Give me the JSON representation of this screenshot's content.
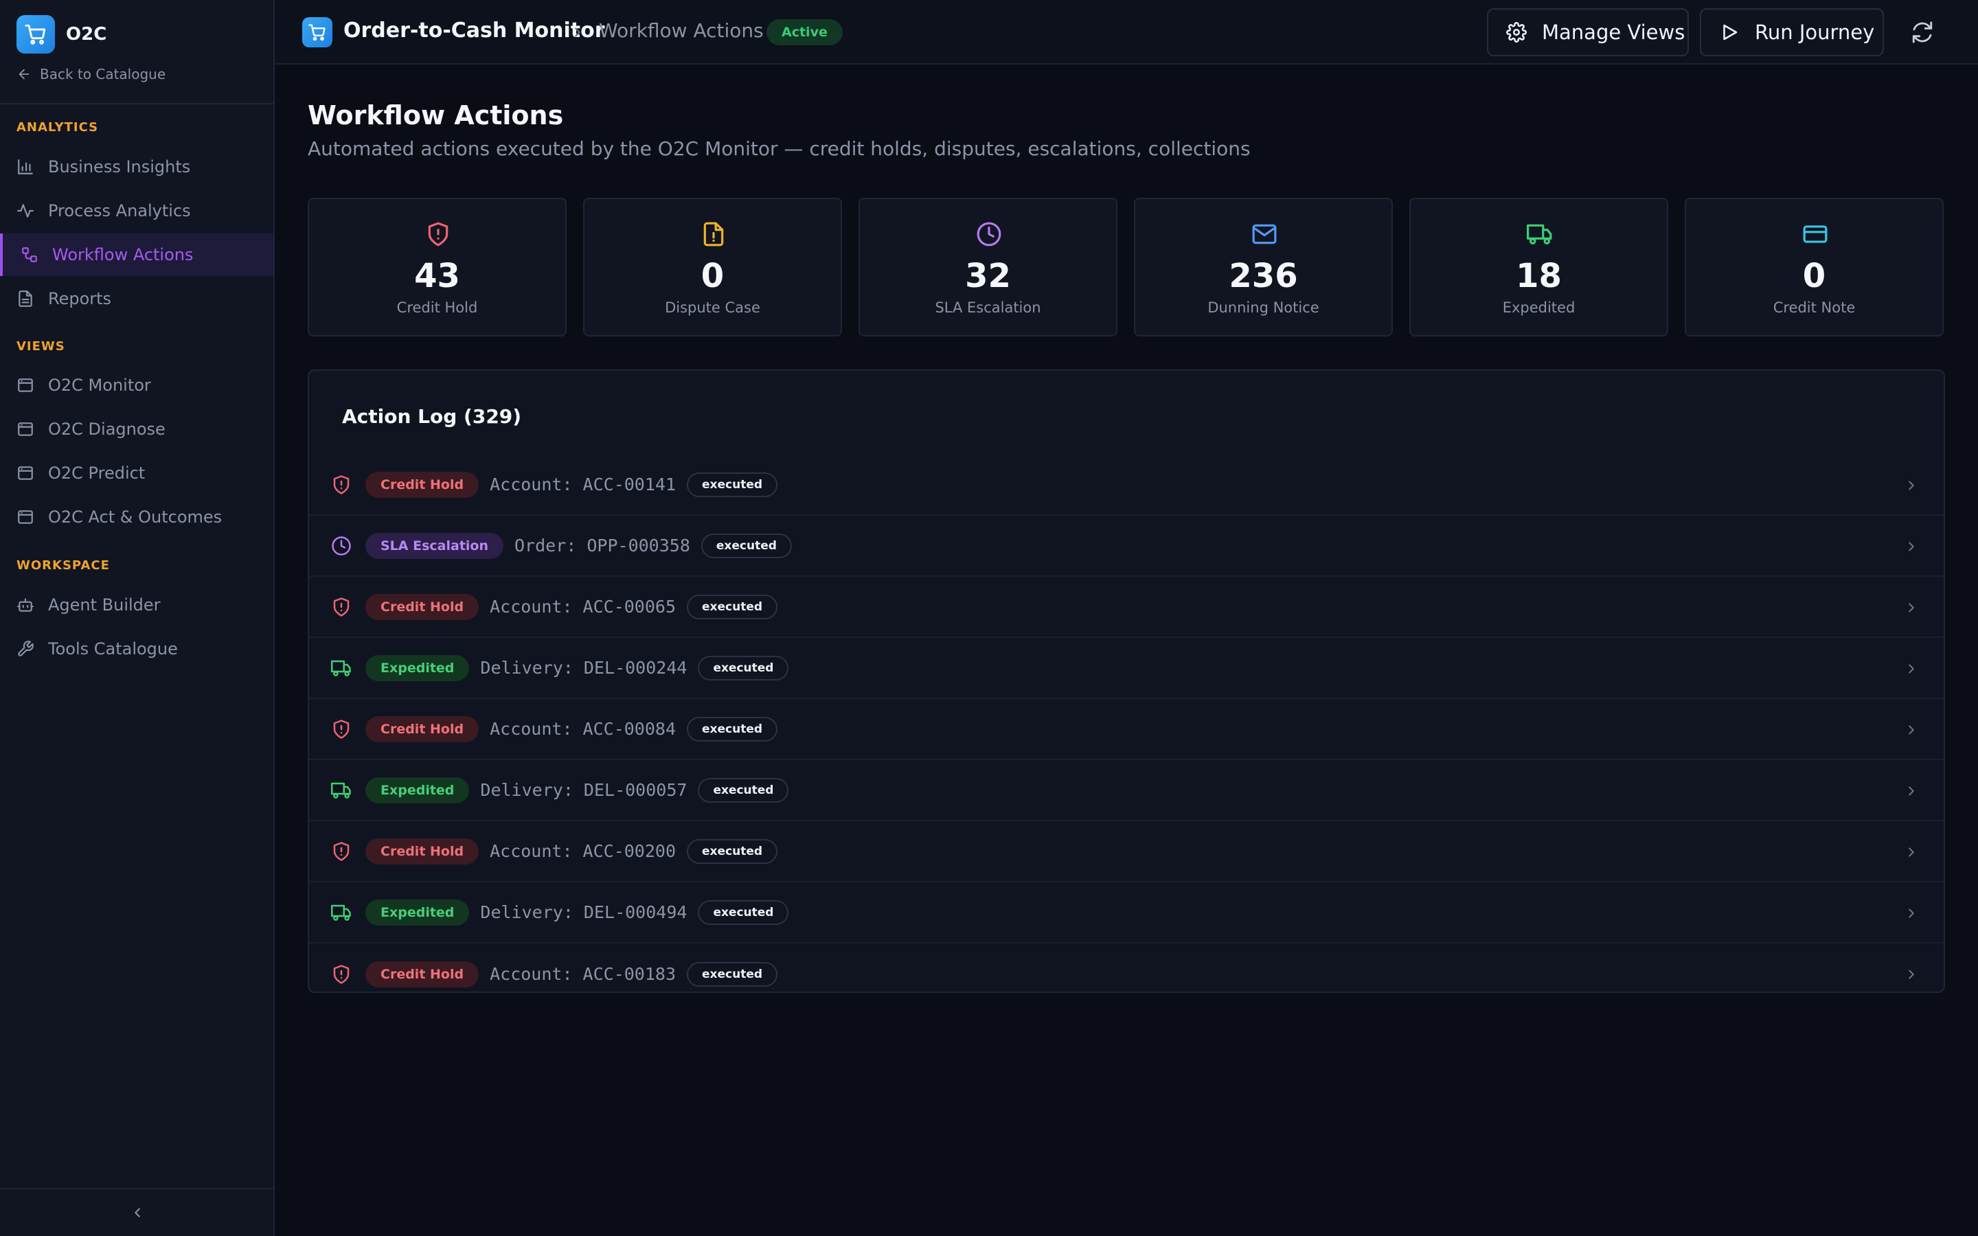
{
  "app": {
    "name": "O2C",
    "back_label": "Back to Catalogue"
  },
  "sidebar": {
    "sections": [
      {
        "title": "ANALYTICS",
        "items": [
          {
            "label": "Business Insights",
            "icon": "bar-chart-icon"
          },
          {
            "label": "Process Analytics",
            "icon": "activity-icon"
          },
          {
            "label": "Workflow Actions",
            "icon": "workflow-icon",
            "active": true
          },
          {
            "label": "Reports",
            "icon": "document-icon"
          }
        ]
      },
      {
        "title": "VIEWS",
        "items": [
          {
            "label": "O2C Monitor",
            "icon": "window-icon"
          },
          {
            "label": "O2C Diagnose",
            "icon": "window-icon"
          },
          {
            "label": "O2C Predict",
            "icon": "window-icon"
          },
          {
            "label": "O2C Act & Outcomes",
            "icon": "window-icon"
          }
        ]
      },
      {
        "title": "WORKSPACE",
        "items": [
          {
            "label": "Agent Builder",
            "icon": "bot-icon"
          },
          {
            "label": "Tools Catalogue",
            "icon": "wrench-icon"
          }
        ]
      }
    ]
  },
  "header": {
    "title": "Order-to-Cash Monitor",
    "breadcrumb": "Workflow Actions",
    "status": "Active",
    "manage_views_label": "Manage Views",
    "run_journey_label": "Run Journey"
  },
  "page": {
    "title": "Workflow Actions",
    "subtitle": "Automated actions executed by the O2C Monitor — credit holds, disputes, escalations, collections"
  },
  "stats": [
    {
      "value": "43",
      "label": "Credit Hold",
      "icon": "shield-alert-icon",
      "color": "#f06272"
    },
    {
      "value": "0",
      "label": "Dispute Case",
      "icon": "file-alert-icon",
      "color": "#f0b429"
    },
    {
      "value": "32",
      "label": "SLA Escalation",
      "icon": "clock-icon",
      "color": "#b37cf2"
    },
    {
      "value": "236",
      "label": "Dunning Notice",
      "icon": "mail-icon",
      "color": "#4f9cf5"
    },
    {
      "value": "18",
      "label": "Expedited",
      "icon": "truck-icon",
      "color": "#3ecf73"
    },
    {
      "value": "0",
      "label": "Credit Note",
      "icon": "credit-card-icon",
      "color": "#38c7e6"
    }
  ],
  "log": {
    "title": "Action Log (329)",
    "rows": [
      {
        "type": "Credit Hold",
        "kind": "hold",
        "target": "Account: ACC-00141",
        "status": "executed"
      },
      {
        "type": "SLA Escalation",
        "kind": "sla",
        "target": "Order: OPP-000358",
        "status": "executed"
      },
      {
        "type": "Credit Hold",
        "kind": "hold",
        "target": "Account: ACC-00065",
        "status": "executed"
      },
      {
        "type": "Expedited",
        "kind": "exp",
        "target": "Delivery: DEL-000244",
        "status": "executed"
      },
      {
        "type": "Credit Hold",
        "kind": "hold",
        "target": "Account: ACC-00084",
        "status": "executed"
      },
      {
        "type": "Expedited",
        "kind": "exp",
        "target": "Delivery: DEL-000057",
        "status": "executed"
      },
      {
        "type": "Credit Hold",
        "kind": "hold",
        "target": "Account: ACC-00200",
        "status": "executed"
      },
      {
        "type": "Expedited",
        "kind": "exp",
        "target": "Delivery: DEL-000494",
        "status": "executed"
      },
      {
        "type": "Credit Hold",
        "kind": "hold",
        "target": "Account: ACC-00183",
        "status": "executed"
      }
    ]
  }
}
